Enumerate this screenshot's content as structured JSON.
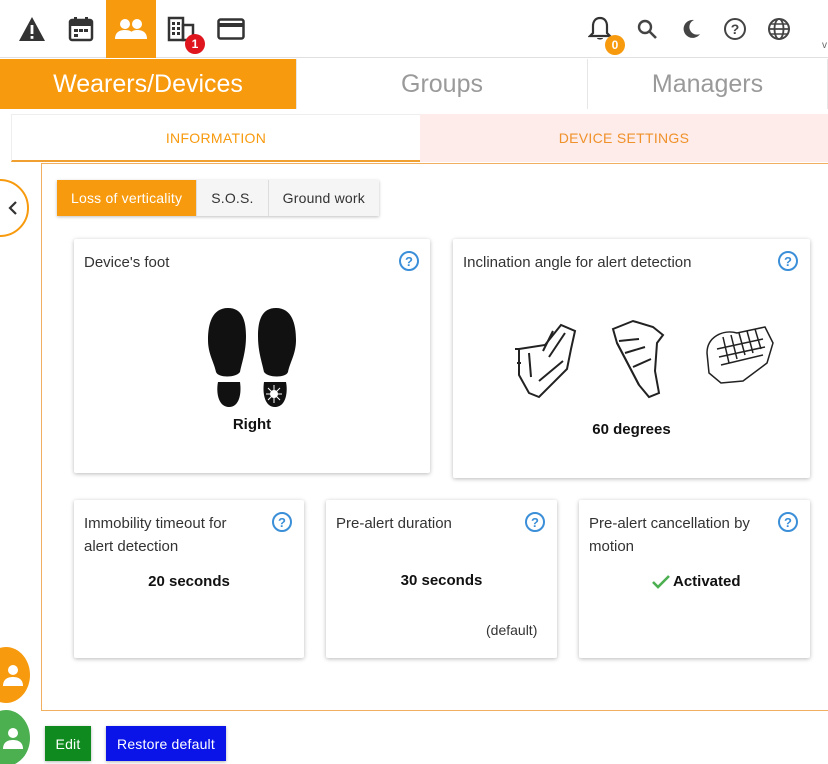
{
  "topbar": {
    "icons": [
      "alert-triangle-icon",
      "calendar-icon",
      "users-icon",
      "building-icon",
      "card-icon",
      "bell-icon",
      "search-icon",
      "moon-icon",
      "help-icon",
      "globe-icon"
    ],
    "building_badge": "1",
    "notification_badge": "0",
    "edge_text": "v"
  },
  "main_tabs": [
    {
      "label": "Wearers/Devices"
    },
    {
      "label": "Groups"
    },
    {
      "label": "Managers"
    }
  ],
  "sub_tabs": [
    {
      "label": "INFORMATION"
    },
    {
      "label": "DEVICE SETTINGS"
    }
  ],
  "alert_types": [
    {
      "label": "Loss of verticality"
    },
    {
      "label": "S.O.S."
    },
    {
      "label": "Ground work"
    }
  ],
  "cards": {
    "device_foot": {
      "title": "Device's foot",
      "value": "Right",
      "help": "?"
    },
    "inclination": {
      "title": "Inclination angle for alert detection",
      "value": "60 degrees",
      "help": "?"
    },
    "immobility": {
      "title_line1": "Immobility timeout for",
      "title_line2": "alert detection",
      "value": "20 seconds",
      "help": "?"
    },
    "pre_alert": {
      "title": "Pre-alert duration",
      "value": "30 seconds",
      "note": "(default)",
      "help": "?"
    },
    "cancellation": {
      "title_line1": "Pre-alert cancellation by",
      "title_line2": "motion",
      "value": "Activated",
      "help": "?"
    }
  },
  "buttons": {
    "edit": "Edit",
    "restore": "Restore default"
  },
  "colors": {
    "accent": "#f79a0e",
    "help": "#3a8fd8",
    "success": "#4caf50",
    "edit": "#0f8a1e",
    "restore": "#0a14e8",
    "badge_red": "#e0161e"
  }
}
